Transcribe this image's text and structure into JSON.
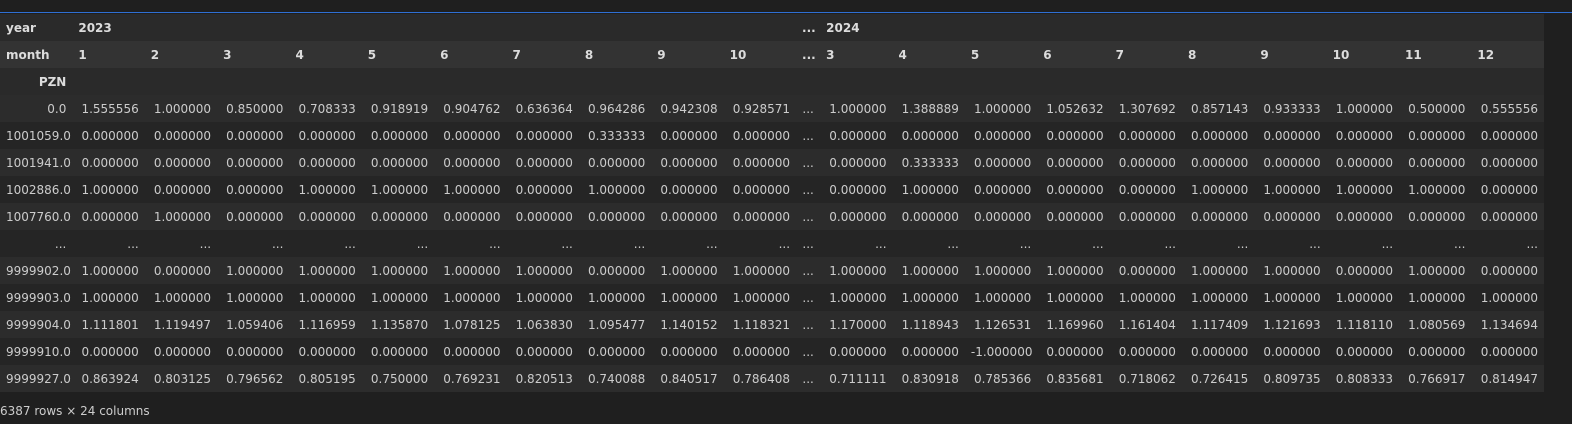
{
  "header": {
    "year_label": "year",
    "month_label": "month",
    "index_label": "PZN",
    "year_groups": [
      {
        "label": "2023",
        "span": 10
      },
      {
        "label": "...",
        "span": 1
      },
      {
        "label": "2024",
        "span": 10
      }
    ],
    "months": [
      "1",
      "2",
      "3",
      "4",
      "5",
      "6",
      "7",
      "8",
      "9",
      "10",
      "...",
      "3",
      "4",
      "5",
      "6",
      "7",
      "8",
      "9",
      "10",
      "11",
      "12"
    ]
  },
  "rows": [
    {
      "index": "0.0",
      "cells": [
        "1.555556",
        "1.000000",
        "0.850000",
        "0.708333",
        "0.918919",
        "0.904762",
        "0.636364",
        "0.964286",
        "0.942308",
        "0.928571",
        "...",
        "1.000000",
        "1.388889",
        "1.000000",
        "1.052632",
        "1.307692",
        "0.857143",
        "0.933333",
        "1.000000",
        "0.500000",
        "0.555556"
      ]
    },
    {
      "index": "1001059.0",
      "cells": [
        "0.000000",
        "0.000000",
        "0.000000",
        "0.000000",
        "0.000000",
        "0.000000",
        "0.000000",
        "0.333333",
        "0.000000",
        "0.000000",
        "...",
        "0.000000",
        "0.000000",
        "0.000000",
        "0.000000",
        "0.000000",
        "0.000000",
        "0.000000",
        "0.000000",
        "0.000000",
        "0.000000"
      ]
    },
    {
      "index": "1001941.0",
      "cells": [
        "0.000000",
        "0.000000",
        "0.000000",
        "0.000000",
        "0.000000",
        "0.000000",
        "0.000000",
        "0.000000",
        "0.000000",
        "0.000000",
        "...",
        "0.000000",
        "0.333333",
        "0.000000",
        "0.000000",
        "0.000000",
        "0.000000",
        "0.000000",
        "0.000000",
        "0.000000",
        "0.000000"
      ]
    },
    {
      "index": "1002886.0",
      "cells": [
        "1.000000",
        "0.000000",
        "0.000000",
        "1.000000",
        "1.000000",
        "1.000000",
        "0.000000",
        "1.000000",
        "0.000000",
        "0.000000",
        "...",
        "0.000000",
        "1.000000",
        "0.000000",
        "0.000000",
        "0.000000",
        "1.000000",
        "1.000000",
        "1.000000",
        "1.000000",
        "0.000000"
      ]
    },
    {
      "index": "1007760.0",
      "cells": [
        "0.000000",
        "1.000000",
        "0.000000",
        "0.000000",
        "0.000000",
        "0.000000",
        "0.000000",
        "0.000000",
        "0.000000",
        "0.000000",
        "...",
        "0.000000",
        "0.000000",
        "0.000000",
        "0.000000",
        "0.000000",
        "0.000000",
        "0.000000",
        "0.000000",
        "0.000000",
        "0.000000"
      ]
    },
    {
      "index": "...",
      "cells": [
        "...",
        "...",
        "...",
        "...",
        "...",
        "...",
        "...",
        "...",
        "...",
        "...",
        "...",
        "...",
        "...",
        "...",
        "...",
        "...",
        "...",
        "...",
        "...",
        "...",
        "..."
      ]
    },
    {
      "index": "9999902.0",
      "cells": [
        "1.000000",
        "0.000000",
        "1.000000",
        "1.000000",
        "1.000000",
        "1.000000",
        "1.000000",
        "0.000000",
        "1.000000",
        "1.000000",
        "...",
        "1.000000",
        "1.000000",
        "1.000000",
        "1.000000",
        "0.000000",
        "1.000000",
        "1.000000",
        "0.000000",
        "1.000000",
        "0.000000"
      ]
    },
    {
      "index": "9999903.0",
      "cells": [
        "1.000000",
        "1.000000",
        "1.000000",
        "1.000000",
        "1.000000",
        "1.000000",
        "1.000000",
        "1.000000",
        "1.000000",
        "1.000000",
        "...",
        "1.000000",
        "1.000000",
        "1.000000",
        "1.000000",
        "1.000000",
        "1.000000",
        "1.000000",
        "1.000000",
        "1.000000",
        "1.000000"
      ]
    },
    {
      "index": "9999904.0",
      "cells": [
        "1.111801",
        "1.119497",
        "1.059406",
        "1.116959",
        "1.135870",
        "1.078125",
        "1.063830",
        "1.095477",
        "1.140152",
        "1.118321",
        "...",
        "1.170000",
        "1.118943",
        "1.126531",
        "1.169960",
        "1.161404",
        "1.117409",
        "1.121693",
        "1.118110",
        "1.080569",
        "1.134694"
      ]
    },
    {
      "index": "9999910.0",
      "cells": [
        "0.000000",
        "0.000000",
        "0.000000",
        "0.000000",
        "0.000000",
        "0.000000",
        "0.000000",
        "0.000000",
        "0.000000",
        "0.000000",
        "...",
        "0.000000",
        "0.000000",
        "-1.000000",
        "0.000000",
        "0.000000",
        "0.000000",
        "0.000000",
        "0.000000",
        "0.000000",
        "0.000000"
      ]
    },
    {
      "index": "9999927.0",
      "cells": [
        "0.863924",
        "0.803125",
        "0.796562",
        "0.805195",
        "0.750000",
        "0.769231",
        "0.820513",
        "0.740088",
        "0.840517",
        "0.786408",
        "...",
        "0.711111",
        "0.830918",
        "0.785366",
        "0.835681",
        "0.718062",
        "0.726415",
        "0.809735",
        "0.808333",
        "0.766917",
        "0.814947"
      ]
    }
  ],
  "footer": {
    "shape_text": "6387 rows × 24 columns"
  },
  "colors": {
    "background": "#1f1f1f",
    "accent_rule": "#2f6fd3"
  }
}
